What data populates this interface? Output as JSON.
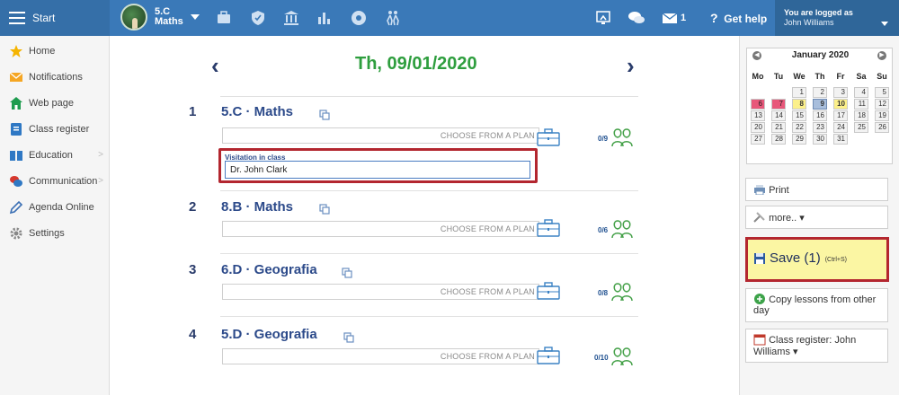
{
  "topbar": {
    "start_label": "Start",
    "class_line1": "5.C",
    "class_line2": "Maths",
    "message_count": "1",
    "help_label": "Get help",
    "logged_label": "You are logged as",
    "user_name": "John Williams",
    "nav_icons": [
      "briefcase-icon",
      "shield-icon",
      "institution-icon",
      "bar-chart-icon",
      "palette-icon",
      "people-icon"
    ]
  },
  "sidebar": {
    "items": [
      {
        "label": "Home",
        "icon": "star-icon"
      },
      {
        "label": "Notifications",
        "icon": "envelope-icon"
      },
      {
        "label": "Web page",
        "icon": "house-icon"
      },
      {
        "label": "Class register",
        "icon": "notebook-icon"
      },
      {
        "label": "Education",
        "icon": "book-icon",
        "has_submenu": true
      },
      {
        "label": "Communication",
        "icon": "chat-icon",
        "has_submenu": true
      },
      {
        "label": "Agenda Online",
        "icon": "pencil-icon"
      },
      {
        "label": "Settings",
        "icon": "gear-icon"
      }
    ]
  },
  "main": {
    "date_title": "Th, 09/01/2020",
    "prev_label": "‹",
    "next_label": "›",
    "lessons": [
      {
        "number": "1",
        "title": "5.C · Maths",
        "plan_placeholder": "CHOOSE FROM A PLAN",
        "count": "0/9"
      },
      {
        "number": "2",
        "title": "8.B · Maths",
        "plan_placeholder": "CHOOSE FROM A PLAN",
        "count": "0/6"
      },
      {
        "number": "3",
        "title": "6.D · Geografia",
        "plan_placeholder": "CHOOSE FROM A PLAN",
        "count": "0/8"
      },
      {
        "number": "4",
        "title": "5.D · Geografia",
        "plan_placeholder": "CHOOSE FROM A PLAN",
        "count": "0/10"
      }
    ],
    "visitation": {
      "label": "Visitation in class",
      "value": "Dr. John Clark"
    }
  },
  "calendar": {
    "month_label": "January 2020",
    "dow": [
      "Mo",
      "Tu",
      "We",
      "Th",
      "Fr",
      "Sa",
      "Su"
    ],
    "weeks": [
      [
        "",
        "",
        "1",
        "2",
        "3",
        "4",
        "5"
      ],
      [
        "6",
        "7",
        "8",
        "9",
        "10",
        "11",
        "12"
      ],
      [
        "13",
        "14",
        "15",
        "16",
        "17",
        "18",
        "19"
      ],
      [
        "20",
        "21",
        "22",
        "23",
        "24",
        "25",
        "26"
      ],
      [
        "27",
        "28",
        "29",
        "30",
        "31",
        "",
        ""
      ]
    ],
    "highlight_colors": {
      "holiday": "#e8577a",
      "school": "#fcf08a",
      "today": "#a8bedc"
    }
  },
  "right": {
    "print_label": "Print",
    "more_label": "more.. ▾",
    "save_label": "Save (1)",
    "save_hint": "(Ctrl+S)",
    "copy_label": "Copy lessons from other day",
    "register_label": "Class register: John Williams ▾"
  },
  "colors": {
    "topbar": "#3a79b8",
    "accent_green": "#2e9e3e",
    "title_blue": "#2c4a8a",
    "highlight_red": "#b3262f",
    "save_yellow": "#fbf6a3"
  }
}
